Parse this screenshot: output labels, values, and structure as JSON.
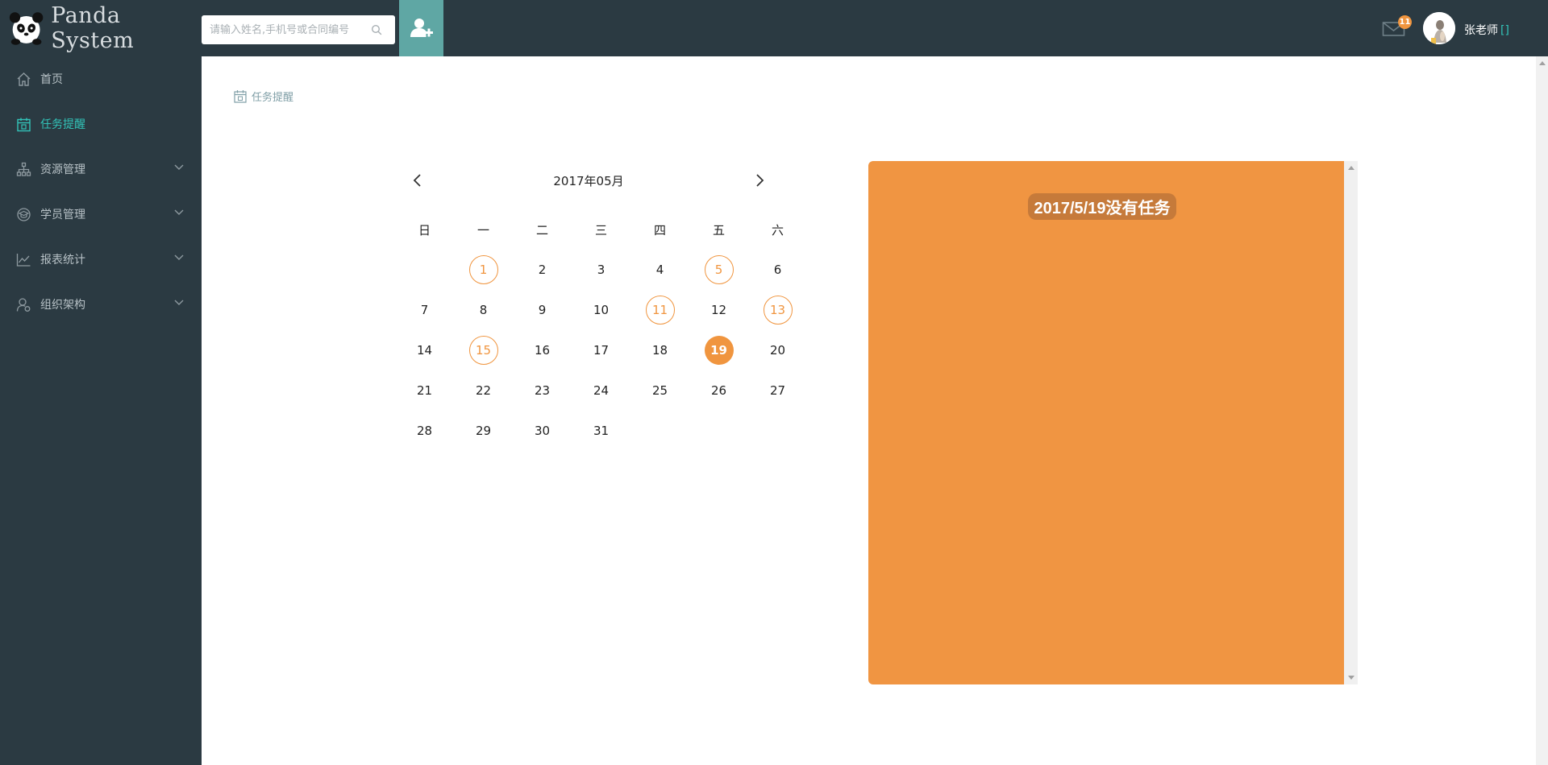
{
  "brand": {
    "name": "Panda System"
  },
  "search": {
    "placeholder": "请输入姓名,手机号或合同编号"
  },
  "header": {
    "mail_count": "11",
    "user_name": "张老师",
    "user_suffix": "[]"
  },
  "sidebar": {
    "items": [
      {
        "label": "首页",
        "icon": "home-icon",
        "active": false
      },
      {
        "label": "任务提醒",
        "icon": "calendar-icon",
        "active": true
      },
      {
        "label": "资源管理",
        "icon": "org-tree-icon",
        "active": false
      },
      {
        "label": "学员管理",
        "icon": "student-icon",
        "active": false
      },
      {
        "label": "报表统计",
        "icon": "chart-icon",
        "active": false
      },
      {
        "label": "组织架构",
        "icon": "user-settings-icon",
        "active": false
      }
    ]
  },
  "breadcrumb": {
    "label": "任务提醒"
  },
  "calendar": {
    "title": "2017年05月",
    "weekdays": [
      "日",
      "一",
      "二",
      "三",
      "四",
      "五",
      "六"
    ],
    "weeks": [
      [
        "",
        "1",
        "2",
        "3",
        "4",
        "5",
        "6"
      ],
      [
        "7",
        "8",
        "9",
        "10",
        "11",
        "12",
        "13"
      ],
      [
        "14",
        "15",
        "16",
        "17",
        "18",
        "19",
        "20"
      ],
      [
        "21",
        "22",
        "23",
        "24",
        "25",
        "26",
        "27"
      ],
      [
        "28",
        "29",
        "30",
        "31",
        "",
        "",
        ""
      ]
    ],
    "task_days": [
      "1",
      "5",
      "11",
      "13",
      "15"
    ],
    "selected_day": "19"
  },
  "task_panel": {
    "title": "2017/5/19没有任务"
  },
  "colors": {
    "topbar": "#2b3a42",
    "accent": "#32c3b8",
    "task_orange": "#f0953f",
    "add_button": "#5fa7a4"
  }
}
